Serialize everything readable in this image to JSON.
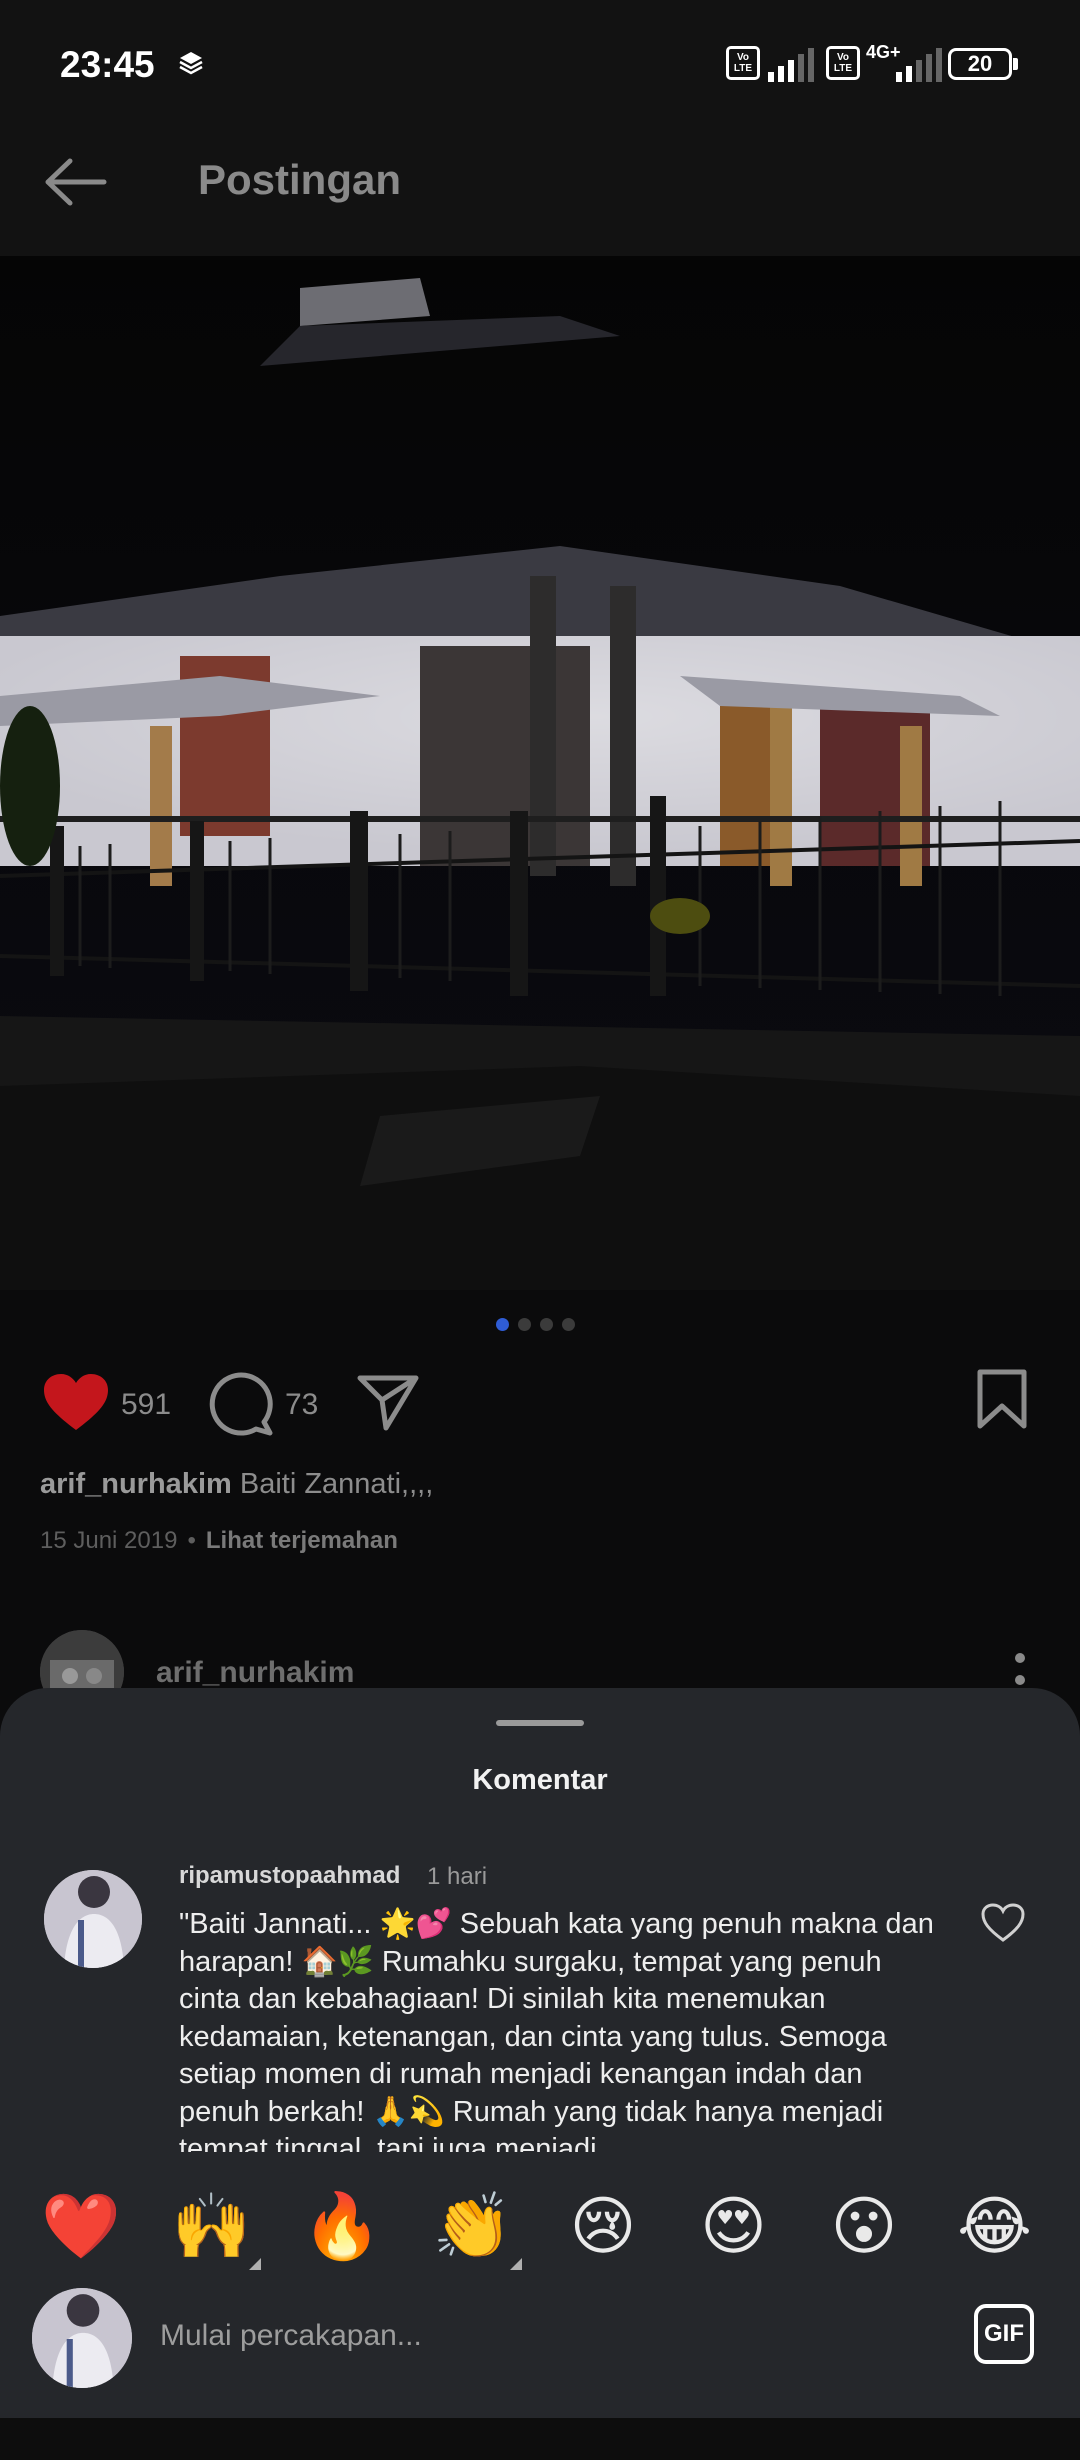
{
  "status_bar": {
    "time": "23:45",
    "network_label": "4G+",
    "volte_label": "Vo LTE",
    "battery": "20"
  },
  "header": {
    "title": "Postingan"
  },
  "post": {
    "carousel": {
      "total": 4,
      "active_index": 0
    },
    "likes": "591",
    "comments": "73",
    "caption_user": "arif_nurhakim",
    "caption_text": "Baiti Zannati,,,,",
    "date": "15 Juni 2019",
    "separator": "•",
    "translate_link": "Lihat terjemahan",
    "author": "arif_nurhakim"
  },
  "comments_sheet": {
    "title": "Komentar",
    "comment": {
      "username": "ripamustopaahmad",
      "time": "1 hari",
      "text": "\"Baiti Jannati... 🌟💕 Sebuah kata yang penuh makna dan harapan! 🏠🌿 Rumahku surgaku, tempat yang penuh cinta dan kebahagiaan! Di sinilah kita menemukan kedamaian, ketenangan, dan cinta yang tulus. Semoga setiap momen di rumah menjadi kenangan indah dan penuh berkah! 🙏💫 Rumah yang tidak hanya menjadi tempat tinggal, tapi juga menjadi"
    },
    "quick_emojis": [
      "❤️",
      "🙌",
      "🔥",
      "👏",
      "😢",
      "😍",
      "😮",
      "😂"
    ],
    "input_placeholder": "Mulai percakapan...",
    "gif_label": "GIF"
  },
  "colors": {
    "like": "#c4161c",
    "carousel_active": "#2f5dd6",
    "sheet_bg": "#25272b"
  }
}
